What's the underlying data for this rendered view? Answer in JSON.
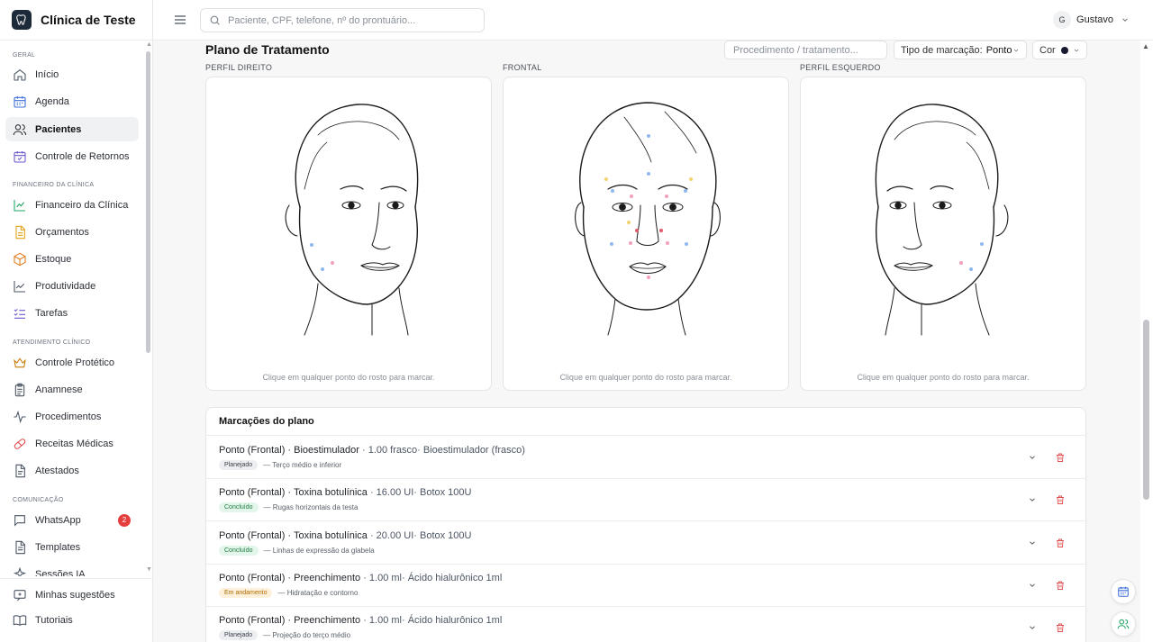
{
  "app": {
    "title": "Clínica de Teste"
  },
  "topbar": {
    "search_placeholder": "Paciente, CPF, telefone, nº do prontuário...",
    "user_initial": "G",
    "user_name": "Gustavo"
  },
  "sidebar": {
    "sections": [
      {
        "label": "GERAL"
      },
      {
        "label": "FINANCEIRO DA CLÍNICA"
      },
      {
        "label": "ATENDIMENTO CLÍNICO"
      },
      {
        "label": "COMUNICAÇÃO"
      }
    ],
    "items": [
      {
        "label": "Início",
        "icon": "home-icon"
      },
      {
        "label": "Agenda",
        "icon": "calendar-icon"
      },
      {
        "label": "Pacientes",
        "icon": "users-icon",
        "active": true
      },
      {
        "label": "Controle de Retornos",
        "icon": "calendar-check-icon"
      },
      {
        "label": "Financeiro da Clínica",
        "icon": "trend-icon"
      },
      {
        "label": "Orçamentos",
        "icon": "document-icon"
      },
      {
        "label": "Estoque",
        "icon": "box-icon"
      },
      {
        "label": "Produtividade",
        "icon": "chart-line-icon"
      },
      {
        "label": "Tarefas",
        "icon": "checklist-icon"
      },
      {
        "label": "Controle Protético",
        "icon": "crown-icon"
      },
      {
        "label": "Anamnese",
        "icon": "clipboard-icon"
      },
      {
        "label": "Procedimentos",
        "icon": "pulse-icon"
      },
      {
        "label": "Receitas Médicas",
        "icon": "pill-icon"
      },
      {
        "label": "Atestados",
        "icon": "file-icon"
      },
      {
        "label": "WhatsApp",
        "icon": "chat-icon",
        "badge": "2"
      },
      {
        "label": "Templates",
        "icon": "template-icon"
      },
      {
        "label": "Sessões IA",
        "icon": "sparkle-icon"
      }
    ],
    "bottom": [
      {
        "label": "Minhas sugestões",
        "icon": "suggestion-icon"
      },
      {
        "label": "Tutoriais",
        "icon": "book-icon"
      }
    ]
  },
  "plan": {
    "title": "Plano de Tratamento",
    "procedure_placeholder": "Procedimento / tratamento...",
    "mark_type_label": "Tipo de marcação:",
    "mark_type_value": "Ponto",
    "color_label": "Cor",
    "color_value": "#1a1a2e",
    "faces": [
      {
        "label": "PERFIL DIREITO",
        "hint": "Clique em qualquer ponto do rosto para marcar."
      },
      {
        "label": "FRONTAL",
        "hint": "Clique em qualquer ponto do rosto para marcar."
      },
      {
        "label": "PERFIL ESQUERDO",
        "hint": "Clique em qualquer ponto do rosto para marcar."
      }
    ]
  },
  "marks": {
    "title": "Marcações do plano",
    "rows": [
      {
        "type": "Ponto (Frontal)",
        "procedure": "Bioestimulador",
        "details": " · 1.00 frasco· Bioestimulador (frasco)",
        "status": "Planejado",
        "status_kind": "plan",
        "note": "— Terço médio e inferior"
      },
      {
        "type": "Ponto (Frontal)",
        "procedure": "Toxina botulínica",
        "details": " · 16.00 UI· Botox 100U",
        "status": "Concluído",
        "status_kind": "done",
        "note": "— Rugas horizontais da testa"
      },
      {
        "type": "Ponto (Frontal)",
        "procedure": "Toxina botulínica",
        "details": " · 20.00 UI· Botox 100U",
        "status": "Concluído",
        "status_kind": "done",
        "note": "— Linhas de expressão da glabela"
      },
      {
        "type": "Ponto (Frontal)",
        "procedure": "Preenchimento",
        "details": " · 1.00 ml· Ácido hialurônico 1ml",
        "status": "Em andamento",
        "status_kind": "prog",
        "note": "— Hidratação e contorno"
      },
      {
        "type": "Ponto (Frontal)",
        "procedure": "Preenchimento",
        "details": " · 1.00 ml· Ácido hialurônico 1ml",
        "status": "Planejado",
        "status_kind": "plan",
        "note": "— Projeção do terço médio"
      }
    ]
  },
  "colors": {
    "accent_active": "#f0f1f3",
    "trash": "#e05252",
    "dot_blue": "#8fb8f0",
    "dot_pink": "#f2a0b8",
    "dot_yellow": "#f3d36b",
    "dot_red": "#e25b6b"
  }
}
